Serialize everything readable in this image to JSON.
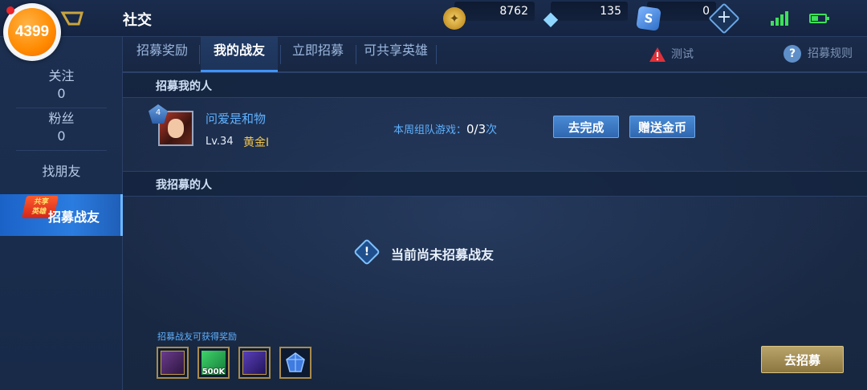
{
  "header": {
    "logo_text": "4399",
    "title": "社交",
    "currencies": {
      "gold": "8762",
      "diamond": "135",
      "coupon": "0"
    }
  },
  "sidebar": {
    "follow_label": "关注",
    "follow_count": "0",
    "fans_label": "粉丝",
    "fans_count": "0",
    "find_friends": "找朋友",
    "recruit": "招募战友",
    "badge_line1": "共享",
    "badge_line2": "英雄"
  },
  "tabs": [
    {
      "label": "招募奖励"
    },
    {
      "label": "我的战友",
      "active": true
    },
    {
      "label": "立即招募"
    },
    {
      "label": "可共享英雄"
    }
  ],
  "top_actions": {
    "test_label": "测试",
    "rules_label": "招募规则"
  },
  "recruiter_section": {
    "title": "招募我的人",
    "friend": {
      "name": "问爱是和物",
      "level": "Lv.34",
      "rank": "黄金I",
      "rank_badge": "4",
      "weekly_label": "本周组队游戏：",
      "weekly_progress": "0/3",
      "weekly_unit": "次",
      "complete_button": "去完成",
      "gift_button": "赠送金币"
    }
  },
  "recruited_section": {
    "title": "我招募的人",
    "empty_text": "当前尚未招募战友"
  },
  "rewards": {
    "label": "招募战友可获得奖励",
    "items": [
      {
        "icon": "card-box-icon"
      },
      {
        "icon": "ticket-icon",
        "text": "500K"
      },
      {
        "icon": "hero-card-icon"
      },
      {
        "icon": "crystal-icon"
      }
    ],
    "go_button": "去招募"
  }
}
